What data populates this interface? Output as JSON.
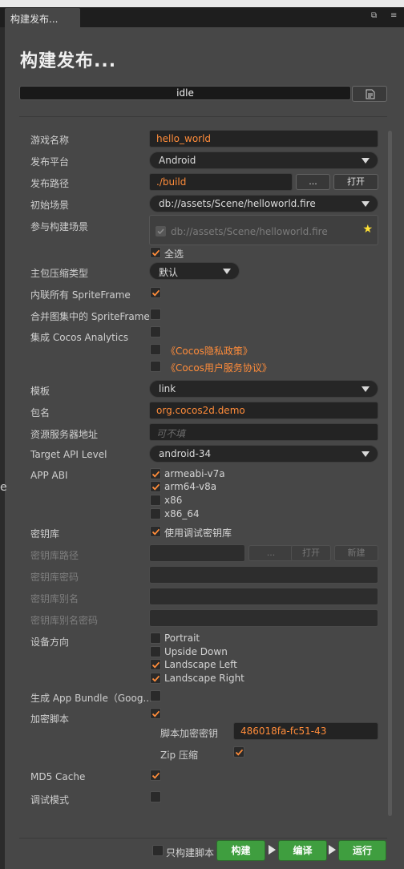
{
  "tab": {
    "title": "构建发布..."
  },
  "panel": {
    "title": "构建发布..."
  },
  "status": {
    "text": "idle"
  },
  "form": {
    "game_name": {
      "label": "游戏名称",
      "value": "hello_world"
    },
    "platform": {
      "label": "发布平台",
      "value": "Android"
    },
    "build_path": {
      "label": "发布路径",
      "value": "./build",
      "browse": "...",
      "open": "打开"
    },
    "start_scene": {
      "label": "初始场景",
      "value": "db://assets/Scene/helloworld.fire"
    },
    "scenes": {
      "label": "参与构建场景",
      "item": "db://assets/Scene/helloworld.fire",
      "select_all": "全选"
    },
    "compression": {
      "label": "主包压缩类型",
      "value": "默认"
    },
    "inline_spriteframe": {
      "label": "内联所有 SpriteFrame"
    },
    "merge_spriteframe": {
      "label": "合并图集中的 SpriteFrame"
    },
    "analytics": {
      "label": "集成 Cocos Analytics",
      "privacy": "《Cocos隐私政策》",
      "terms": "《Cocos用户服务协议》"
    },
    "template": {
      "label": "模板",
      "value": "link"
    },
    "package": {
      "label": "包名",
      "value": "org.cocos2d.demo"
    },
    "res_server": {
      "label": "资源服务器地址",
      "placeholder": "可不填"
    },
    "target_api": {
      "label": "Target API Level",
      "value": "android-34"
    },
    "app_abi": {
      "label": "APP ABI",
      "options": [
        "armeabi-v7a",
        "arm64-v8a",
        "x86",
        "x86_64"
      ]
    },
    "keystore": {
      "label": "密钥库",
      "use_debug": "使用调试密钥库"
    },
    "keystore_path": {
      "label": "密钥库路径",
      "browse": "...",
      "open": "打开",
      "new": "新建"
    },
    "keystore_password": {
      "label": "密钥库密码"
    },
    "keystore_alias": {
      "label": "密钥库别名"
    },
    "keystore_alias_password": {
      "label": "密钥库别名密码"
    },
    "orientation": {
      "label": "设备方向",
      "options": [
        "Portrait",
        "Upside Down",
        "Landscape Left",
        "Landscape Right"
      ]
    },
    "app_bundle": {
      "label": "生成 App Bundle（Goog..."
    },
    "encrypt_js": {
      "label": "加密脚本",
      "key_label": "脚本加密密钥",
      "key_value": "486018fa-fc51-43",
      "zip_label": "Zip 压缩"
    },
    "md5_cache": {
      "label": "MD5 Cache"
    },
    "debug_mode": {
      "label": "调试模式"
    }
  },
  "footer": {
    "only_script": "只构建脚本",
    "build": "构建",
    "compile": "编译",
    "run": "运行"
  },
  "left_edge": {
    "text": "e"
  }
}
